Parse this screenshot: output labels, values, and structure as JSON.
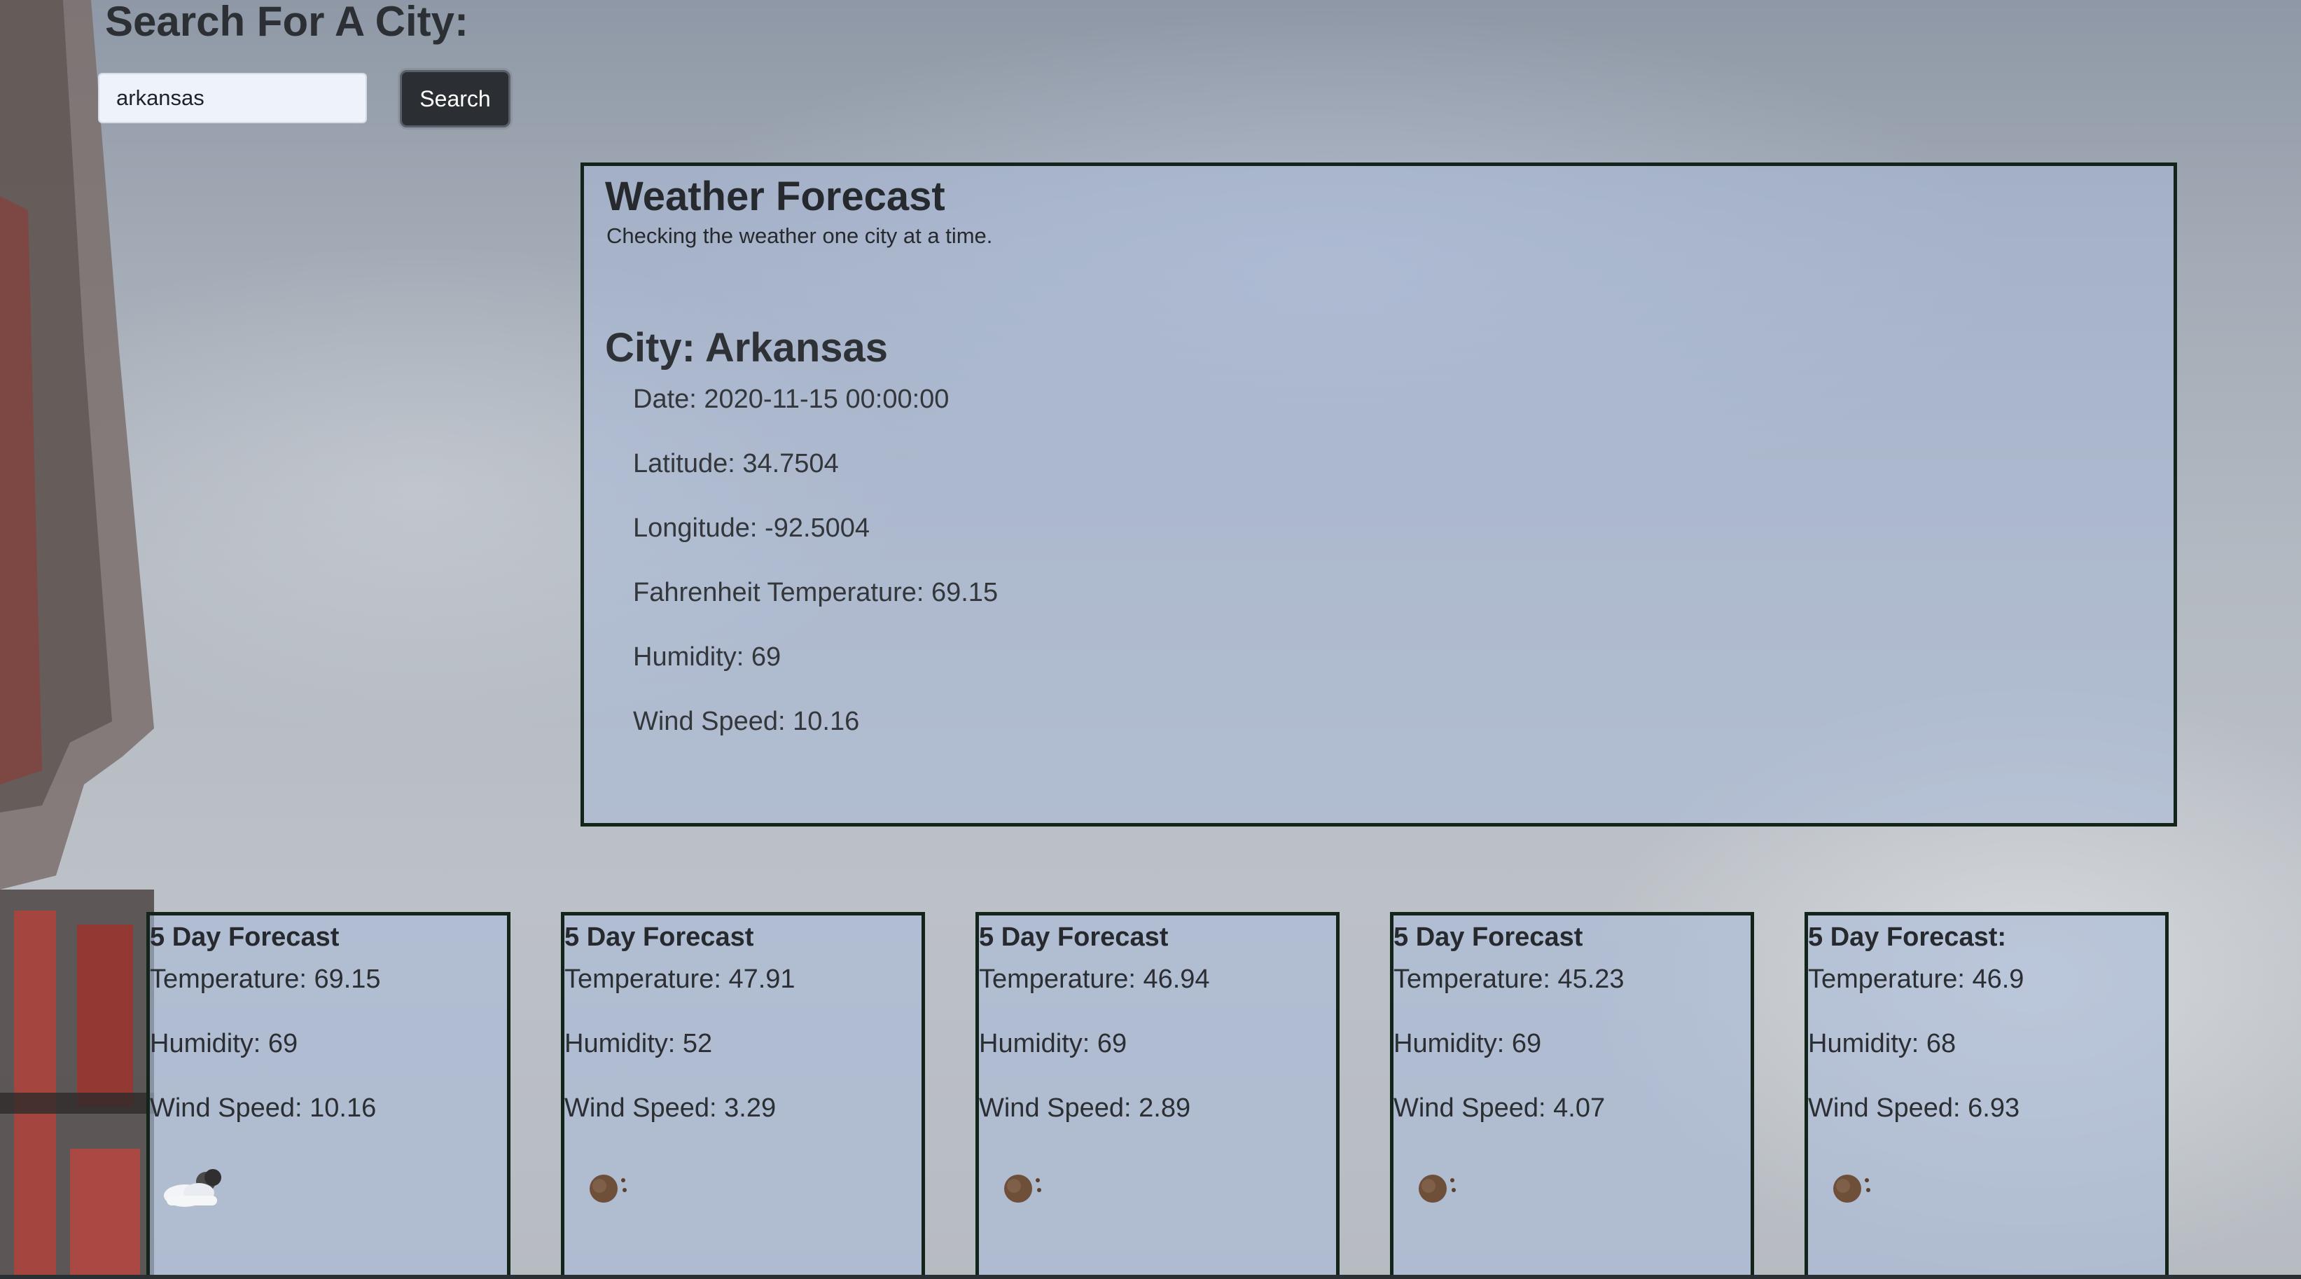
{
  "search": {
    "title": "Search For A City:",
    "input_value": "arkansas",
    "button_label": "Search"
  },
  "header": {
    "title": "Weather Forecast",
    "subtitle": "Checking the weather one city at a time."
  },
  "current": {
    "city": "City: Arkansas",
    "date": "Date: 2020-11-15 00:00:00",
    "latitude": "Latitude: 34.7504",
    "longitude": "Longitude: -92.5004",
    "temperature": "Fahrenheit Temperature: 69.15",
    "humidity": "Humidity: 69",
    "wind_speed": "Wind Speed: 10.16"
  },
  "forecast": [
    {
      "title": "5 Day Forecast",
      "temperature": "Temperature: 69.15",
      "humidity": "Humidity: 69",
      "wind_speed": "Wind Speed: 10.16",
      "icon": "partly-cloudy-night-icon"
    },
    {
      "title": "5 Day Forecast",
      "temperature": "Temperature: 47.91",
      "humidity": "Humidity: 52",
      "wind_speed": "Wind Speed: 3.29",
      "icon": "clear-night-icon"
    },
    {
      "title": "5 Day Forecast",
      "temperature": "Temperature: 46.94",
      "humidity": "Humidity: 69",
      "wind_speed": "Wind Speed: 2.89",
      "icon": "clear-night-icon"
    },
    {
      "title": "5 Day Forecast",
      "temperature": "Temperature: 45.23",
      "humidity": "Humidity: 69",
      "wind_speed": "Wind Speed: 4.07",
      "icon": "clear-night-icon"
    },
    {
      "title": "5 Day Forecast:",
      "temperature": "Temperature: 46.9",
      "humidity": "Humidity: 68",
      "wind_speed": "Wind Speed: 6.93",
      "icon": "clear-night-icon"
    }
  ]
}
